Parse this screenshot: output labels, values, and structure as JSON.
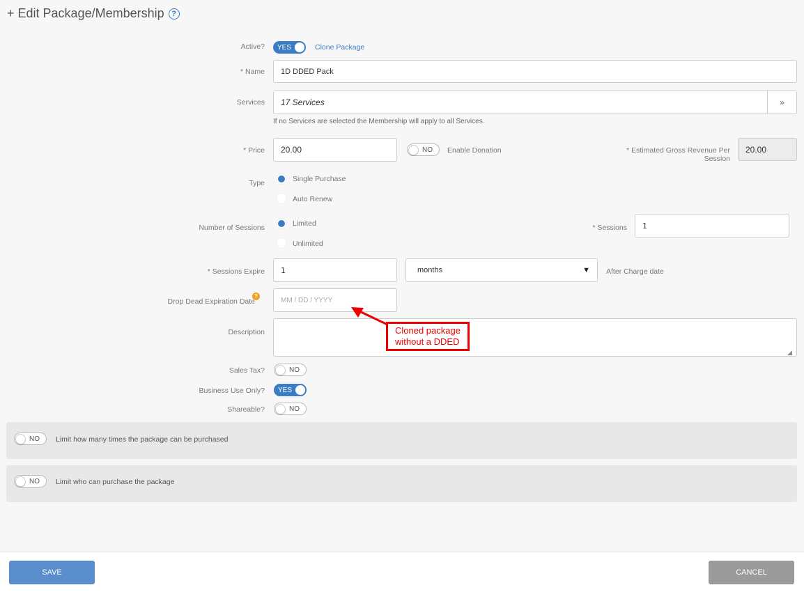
{
  "page": {
    "title": "+ Edit Package/Membership",
    "help_icon": "?"
  },
  "form": {
    "active": {
      "label": "Active?",
      "toggle": "YES",
      "clone_link": "Clone Package"
    },
    "name": {
      "label": "* Name",
      "value": "1D DDED Pack"
    },
    "services": {
      "label": "Services",
      "value": "17 Services",
      "hint": "If no Services are selected the Membership will apply to all Services."
    },
    "price": {
      "label": "* Price",
      "value": "20.00",
      "donation_toggle": "NO",
      "donation_label": "Enable Donation"
    },
    "revenue": {
      "label_line1": "* Estimated Gross Revenue Per",
      "label_line2": "Session",
      "value": "20.00"
    },
    "type": {
      "label": "Type",
      "options": [
        "Single Purchase",
        "Auto Renew"
      ],
      "selected": "Single Purchase"
    },
    "sessions_number": {
      "label": "Number of Sessions",
      "options": [
        "Limited",
        "Unlimited"
      ],
      "selected": "Limited"
    },
    "sessions": {
      "label": "* Sessions",
      "value": "1"
    },
    "sessions_expire": {
      "label": "* Sessions Expire",
      "value": "1",
      "unit": "months",
      "suffix": "After Charge date"
    },
    "dded": {
      "label": "Drop Dead Expiration Date",
      "placeholder": "MM / DD / YYYY"
    },
    "description": {
      "label": "Description",
      "value": ""
    },
    "sales_tax": {
      "label": "Sales Tax?",
      "toggle": "NO"
    },
    "business_use": {
      "label": "Business Use Only?",
      "toggle": "YES"
    },
    "shareable": {
      "label": "Shareable?",
      "toggle": "NO"
    }
  },
  "panels": {
    "limit_purchases": {
      "toggle": "NO",
      "label": "Limit how many times the package can be purchased"
    },
    "limit_who": {
      "toggle": "NO",
      "label": "Limit who can purchase the package"
    }
  },
  "annotation": {
    "line1": "Cloned package",
    "line2": "without a DDED"
  },
  "footer": {
    "save": "SAVE",
    "cancel": "CANCEL"
  },
  "colors": {
    "accent": "#3b7dc4",
    "callout": "#ee0000",
    "save_bg": "#5a8dcb",
    "cancel_bg": "#9a9a9a"
  }
}
